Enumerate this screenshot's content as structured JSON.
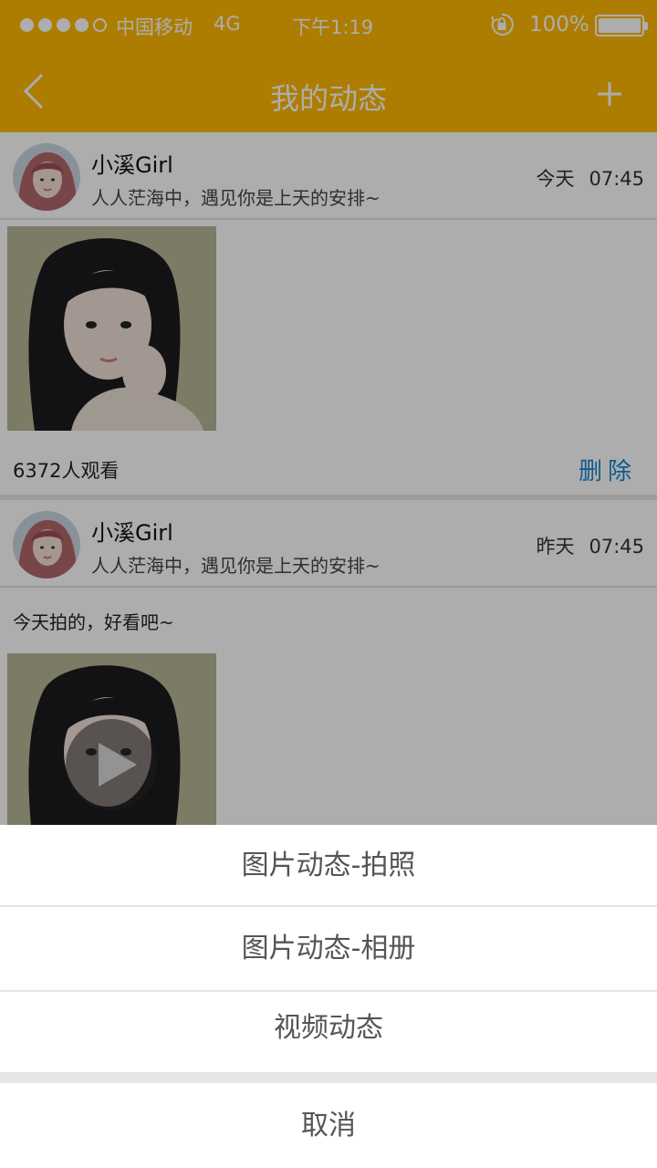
{
  "status_bar": {
    "carrier": "中国移动",
    "network": "4G",
    "time": "下午1:19",
    "battery": "100%",
    "signal_bars_filled": 4,
    "signal_bars_total": 5,
    "battery_level": 1.0
  },
  "nav": {
    "title": "我的动态",
    "back_icon": "chevron-left-icon",
    "add_icon": "plus-icon"
  },
  "posts": [
    {
      "username": "小溪Girl",
      "signature": "人人茫海中，遇见你是上天的安排~",
      "day": "今天",
      "time": "07:45",
      "views": "6372人观看",
      "delete_label": "删除"
    },
    {
      "username": "小溪Girl",
      "signature": "人人茫海中，遇见你是上天的安排~",
      "day": "昨天",
      "time": "07:45",
      "text": "今天拍的，好看吧~",
      "media_icon": "play-icon"
    }
  ],
  "action_sheet": {
    "options": [
      "图片动态-拍照",
      "图片动态-相册",
      "视频动态"
    ],
    "cancel": "取消"
  },
  "colors": {
    "accent": "#FEB900",
    "link": "#1a86d0",
    "overlay": "rgba(0,0,0,0.32)"
  }
}
